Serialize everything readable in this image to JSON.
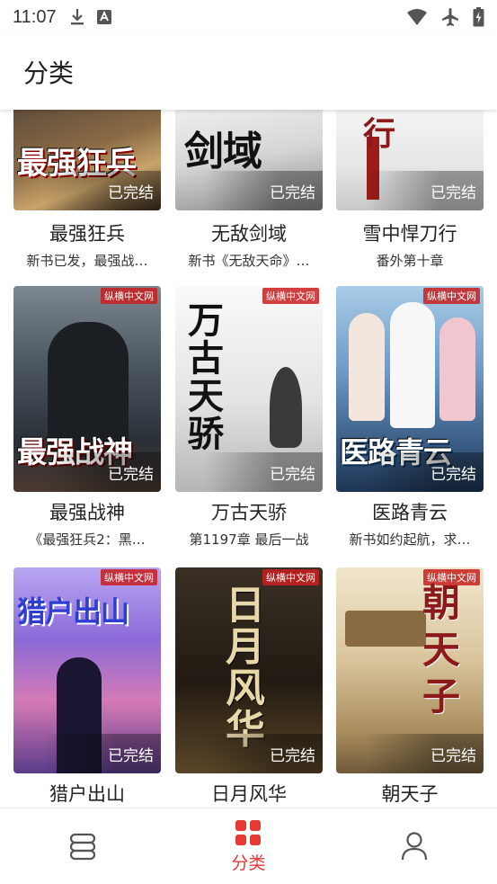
{
  "status_bar": {
    "time": "11:07"
  },
  "header": {
    "title": "分类"
  },
  "books": [
    {
      "title": "最强狂兵",
      "desc": "新书已发，最强战…",
      "status": "已完结",
      "cover_text": "最强狂兵",
      "cover_colors": [
        "#5a4a3a",
        "#c9a46a"
      ]
    },
    {
      "title": "无敌剑域",
      "desc": "新书《无敌天命》…",
      "status": "已完结",
      "cover_text": "剑域",
      "cover_colors": [
        "#e8e8e8",
        "#9a9a9a"
      ]
    },
    {
      "title": "雪中悍刀行",
      "desc": "番外第十章",
      "status": "已完结",
      "cover_text": "行",
      "cover_colors": [
        "#f2f2f2",
        "#8c1a1a"
      ]
    },
    {
      "title": "最强战神",
      "desc": "《最强狂兵2：黑…",
      "status": "已完结",
      "cover_text": "最强战神",
      "cover_colors": [
        "#3e4a57",
        "#1d232b"
      ],
      "publisher": "纵横中文网"
    },
    {
      "title": "万古天骄",
      "desc": "第1197章 最后一战",
      "status": "已完结",
      "cover_text": "万古天骄",
      "cover_colors": [
        "#f0f0f0",
        "#bcbcbc"
      ],
      "publisher": "纵横中文网"
    },
    {
      "title": "医路青云",
      "desc": "新书如约起航，求…",
      "status": "已完结",
      "cover_text": "医路青云",
      "cover_colors": [
        "#7fb0d8",
        "#2b4e7a"
      ],
      "publisher": "纵横中文网"
    },
    {
      "title": "猎户出山",
      "desc": "",
      "status": "已完结",
      "cover_text": "猎户出山",
      "cover_colors": [
        "#8a6ad8",
        "#e07ab8"
      ],
      "publisher": "纵横中文网"
    },
    {
      "title": "日月风华",
      "desc": "",
      "status": "已完结",
      "cover_text": "日月风华",
      "cover_colors": [
        "#2a2218",
        "#6b5630"
      ],
      "publisher": "纵横中文网"
    },
    {
      "title": "朝天子",
      "desc": "",
      "status": "已完结",
      "cover_text": "朝天子",
      "cover_colors": [
        "#e8d9b8",
        "#a88c5c"
      ],
      "publisher": "纵横中文网"
    }
  ],
  "bottom_nav": {
    "active_label": "分类"
  },
  "colors": {
    "accent": "#e53935"
  }
}
